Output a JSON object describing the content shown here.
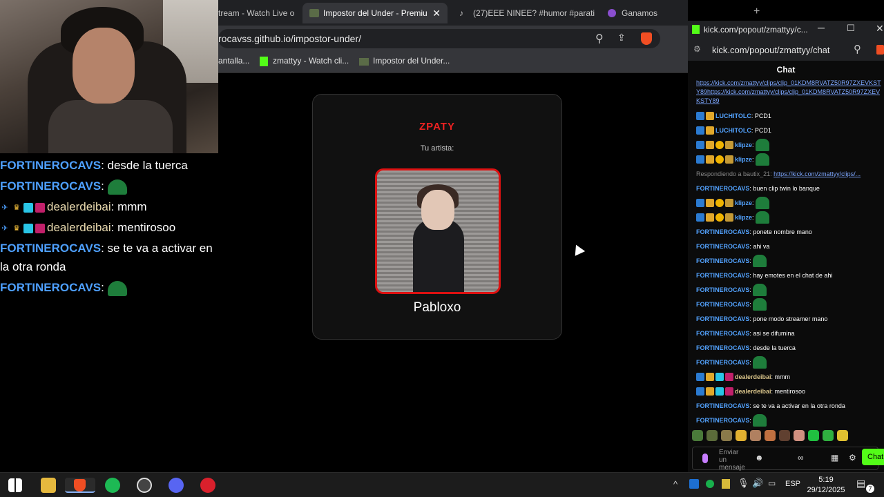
{
  "webcam": {},
  "overlay_chat": [
    {
      "user": "FORTINEROCAVS",
      "text": ": desde la tuerca",
      "emote": false,
      "badges": false
    },
    {
      "user": "FORTINEROCAVS",
      "text": ":",
      "emote": true,
      "badges": false
    },
    {
      "user": "dealerdeibai",
      "text": ": mmm",
      "emote": false,
      "badges": true
    },
    {
      "user": "dealerdeibai",
      "text": ": mentirosoo",
      "emote": false,
      "badges": true
    },
    {
      "user": "FORTINEROCAVS",
      "text": ": se te va a activar en la otra ronda",
      "emote": false,
      "badges": false
    },
    {
      "user": "FORTINEROCAVS",
      "text": ":",
      "emote": true,
      "badges": false
    }
  ],
  "browser": {
    "tabs": [
      {
        "label": "tream - Watch Live o"
      },
      {
        "label": "Impostor del Under - Premiu",
        "active": true
      },
      {
        "label": "(27)EEE NINEE? #humor #parati #"
      },
      {
        "label": "Ganamos"
      }
    ],
    "address": "rocavss.github.io/impostor-under/",
    "bookmarks": [
      "antalla...",
      "zmattyy - Watch cli...",
      "Impostor del Under..."
    ]
  },
  "card": {
    "logo": "ZPATY",
    "subtitle": "Tu artista:",
    "artist": "Pabloxo"
  },
  "kick": {
    "window_title": "kick.com/popout/zmattyy/c...",
    "address": "kick.com/popout/zmattyy/chat",
    "header": "Chat",
    "link_msg": "https://kick.com/zmattyy/clips/clip_01KDM8RVATZ50R97ZXEVKSTY89https://kick.com/zmattyy/clips/clip_01KDM8RVATZ50R97ZXEVKSTY89",
    "messages": [
      {
        "user": "LUCHITOLC",
        "text": ": PCD1",
        "style": "u1"
      },
      {
        "user": "LUCHITOLC",
        "text": ": PCD1",
        "style": "u1"
      },
      {
        "user": "klipze",
        "text": ":",
        "style": "u2"
      },
      {
        "user": "klipze",
        "text": ":",
        "style": "u2"
      },
      {
        "user": "Respondiendo a bautix_21:",
        "text": "https://kick.com/zmattyy/clips/...",
        "style": "reply"
      },
      {
        "user": "FORTINEROCAVS",
        "text": ": buen clip twin lo banque",
        "style": "u1"
      },
      {
        "user": "klipze",
        "text": ":",
        "style": "u2"
      },
      {
        "user": "klipze",
        "text": ":",
        "style": "u2"
      },
      {
        "user": "FORTINEROCAVS",
        "text": ": ponete nombre mano",
        "style": "u1"
      },
      {
        "user": "FORTINEROCAVS",
        "text": ": ahi va",
        "style": "u1"
      },
      {
        "user": "FORTINEROCAVS",
        "text": ":",
        "style": "u1"
      },
      {
        "user": "FORTINEROCAVS",
        "text": ": hay emotes en el chat de ahi",
        "style": "u1"
      },
      {
        "user": "FORTINEROCAVS",
        "text": ":",
        "style": "u1"
      },
      {
        "user": "FORTINEROCAVS",
        "text": ":",
        "style": "u1"
      },
      {
        "user": "FORTINEROCAVS",
        "text": ": pone modo streamer mano",
        "style": "u1"
      },
      {
        "user": "FORTINEROCAVS",
        "text": ": asi se difumina",
        "style": "u1"
      },
      {
        "user": "FORTINEROCAVS",
        "text": ": desde la tuerca",
        "style": "u1"
      },
      {
        "user": "FORTINEROCAVS",
        "text": ":",
        "style": "u1"
      },
      {
        "user": "dealerdeibai",
        "text": ": mmm",
        "style": "u3"
      },
      {
        "user": "dealerdeibai",
        "text": ": mentirosoo",
        "style": "u3"
      },
      {
        "user": "FORTINEROCAVS",
        "text": ": se te va a activar en la otra ronda",
        "style": "u1"
      },
      {
        "user": "FORTINEROCAVS",
        "text": ":",
        "style": "u1"
      }
    ],
    "input_placeholder": "Enviar un mensaje",
    "send_label": "Chat"
  },
  "taskbar": {
    "language": "ESP",
    "time": "5:19",
    "date": "29/12/2025",
    "notifications": "7"
  }
}
